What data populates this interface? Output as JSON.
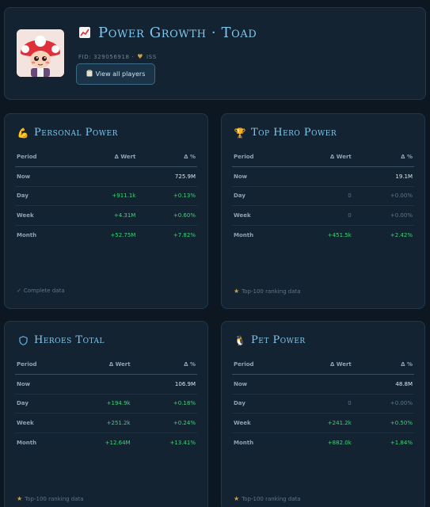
{
  "header": {
    "title": "Power Growth · Toad",
    "title_icon": "chart-up-icon",
    "fid_text": "FID: 329056918 ·",
    "server_text": "ISS",
    "button_label": "View all players",
    "button_icon": "clipboard-icon"
  },
  "table_headers": {
    "period": "Period",
    "wert": "Δ Wert",
    "pct": "Δ %"
  },
  "cards": [
    {
      "title": "Personal Power",
      "icon": "flexed-arm-icon",
      "rows": [
        {
          "period": "Now",
          "wert": "",
          "pct": "725.9M"
        },
        {
          "period": "Day",
          "wert": "+911.1k",
          "pct": "+0.13%"
        },
        {
          "period": "Week",
          "wert": "+4.31M",
          "pct": "+0.60%"
        },
        {
          "period": "Month",
          "wert": "+52.75M",
          "pct": "+7.82%"
        }
      ],
      "footer": "Complete data",
      "footer_icon": "checkmark-icon"
    },
    {
      "title": "Top Hero Power",
      "icon": "trophy-icon",
      "rows": [
        {
          "period": "Now",
          "wert": "",
          "pct": "19.1M"
        },
        {
          "period": "Day",
          "wert": "0",
          "pct": "+0.00%"
        },
        {
          "period": "Week",
          "wert": "0",
          "pct": "+0.00%"
        },
        {
          "period": "Month",
          "wert": "+451.5k",
          "pct": "+2.42%"
        }
      ],
      "footer": "Top-100 ranking data",
      "footer_icon": "star-icon"
    },
    {
      "title": "Heroes Total",
      "icon": "shield-icon",
      "rows": [
        {
          "period": "Now",
          "wert": "",
          "pct": "106.9M"
        },
        {
          "period": "Day",
          "wert": "+194.9k",
          "pct": "+0.18%"
        },
        {
          "period": "Week",
          "wert": "+251.2k",
          "pct": "+0.24%"
        },
        {
          "period": "Month",
          "wert": "+12.64M",
          "pct": "+13.41%"
        }
      ],
      "footer": "Top-100 ranking data",
      "footer_icon": "star-icon"
    },
    {
      "title": "Pet Power",
      "icon": "penguin-icon",
      "rows": [
        {
          "period": "Now",
          "wert": "",
          "pct": "48.8M"
        },
        {
          "period": "Day",
          "wert": "0",
          "pct": "+0.00%"
        },
        {
          "period": "Week",
          "wert": "+241.2k",
          "pct": "+0.50%"
        },
        {
          "period": "Month",
          "wert": "+882.0k",
          "pct": "+1.84%"
        }
      ],
      "footer": "Top-100 ranking data",
      "footer_icon": "star-icon"
    }
  ]
}
